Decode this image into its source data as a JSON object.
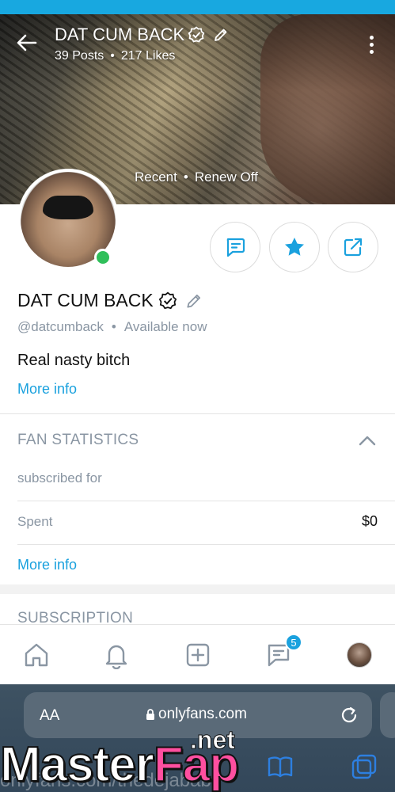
{
  "header": {
    "title": "DAT CUM BACK",
    "posts": "39 Posts",
    "likes": "217 Likes",
    "separator": "•",
    "status_recent": "Recent",
    "status_renew": "Renew Off"
  },
  "profile": {
    "name": "DAT CUM BACK",
    "handle": "@datcumback",
    "availability": "Available now",
    "bio": "Real nasty bitch",
    "more_info": "More info",
    "online_color": "#2fbf5a"
  },
  "actions": {
    "message_icon": "message-icon",
    "favorite_icon": "star-icon",
    "share_icon": "share-icon"
  },
  "fan_statistics": {
    "title": "FAN STATISTICS",
    "subscribed_label": "subscribed for",
    "spent_label": "Spent",
    "spent_value": "$0",
    "more_info": "More info"
  },
  "subscription": {
    "title": "SUBSCRIPTION"
  },
  "bottom_nav": {
    "items": [
      "home-icon",
      "bell-icon",
      "add-post-icon",
      "messages-icon",
      "profile-avatar"
    ],
    "messages_badge": "5"
  },
  "browser": {
    "text_size_label": "AA",
    "url": "onlyfans.com",
    "ghost_url": "onlyfans.com/thedejababe"
  },
  "watermark": {
    "main_a": "Master",
    "main_b": "Fap",
    "suffix": ".net"
  },
  "colors": {
    "accent": "#1aa1de",
    "muted": "#8a96a3",
    "top_bar": "#18a8e0"
  }
}
